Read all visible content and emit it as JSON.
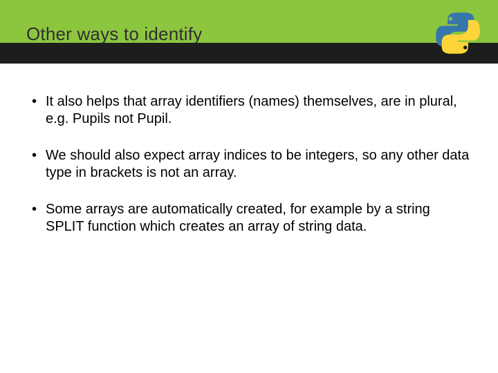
{
  "slide": {
    "title": "Other ways to identify",
    "logo_alt": "python-logo",
    "bullets": [
      "It also helps that array identifiers (names) themselves, are in plural, e.g. Pupils not Pupil.",
      "We should also expect array indices to be integers, so any other data type in brackets is not an array.",
      "Some arrays are automatically created, for example by a string SPLIT function which creates an array of string data."
    ]
  }
}
